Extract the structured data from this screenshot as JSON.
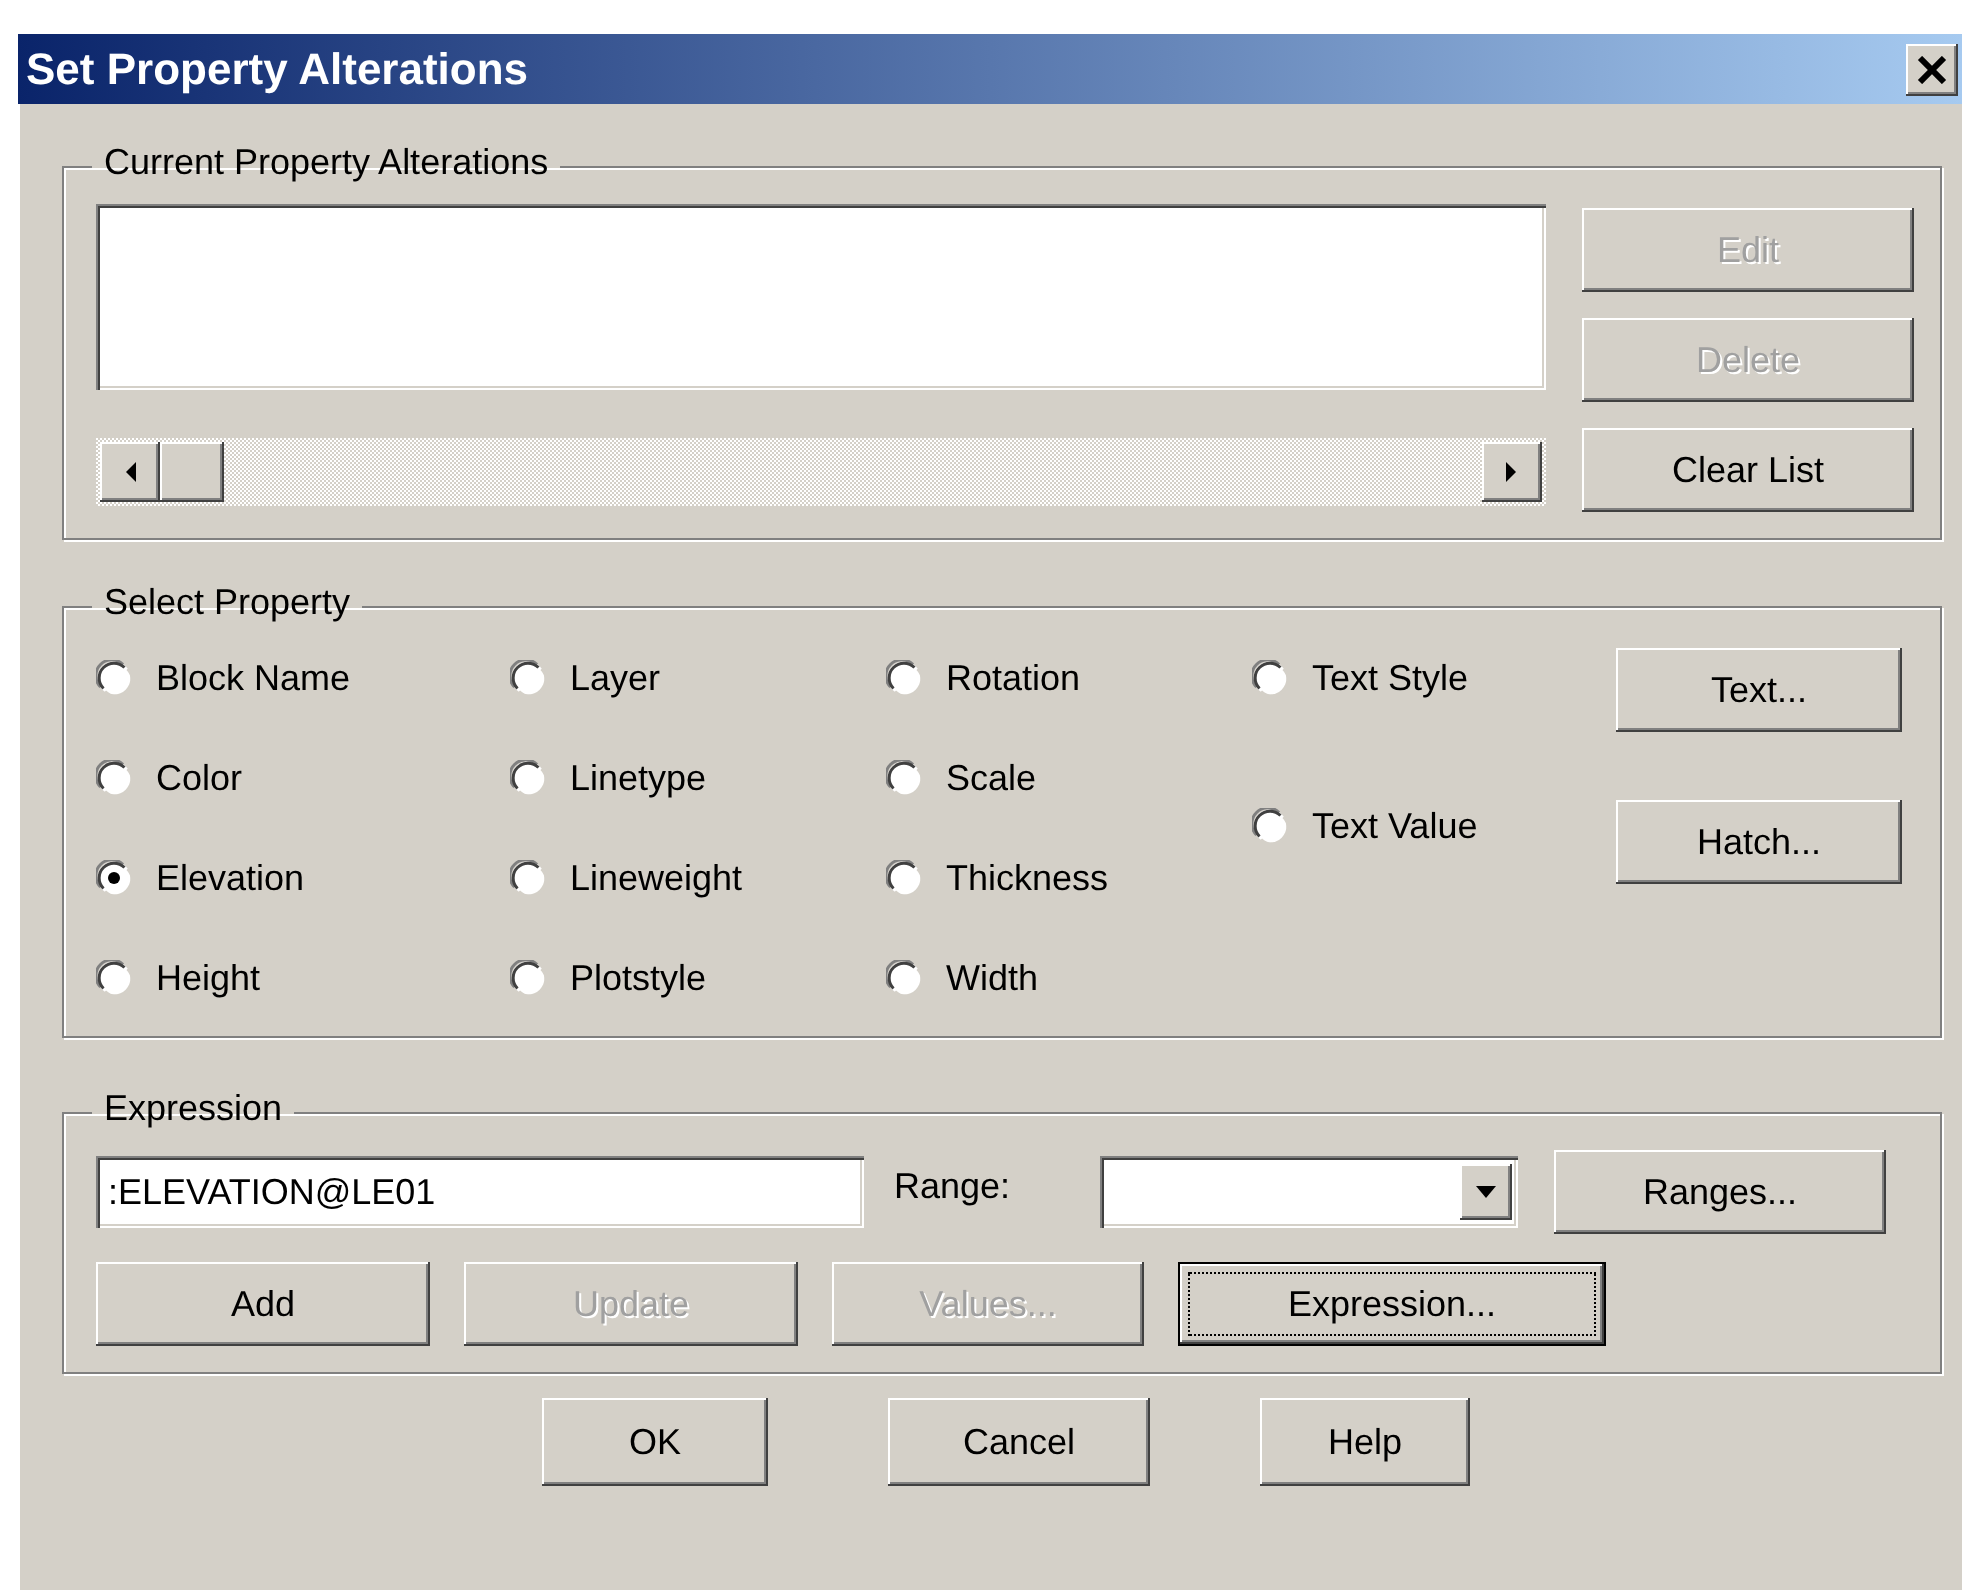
{
  "window": {
    "title": "Set Property Alterations"
  },
  "alterations": {
    "legend": "Current Property Alterations",
    "buttons": [
      {
        "label": "Edit",
        "disabled": true
      },
      {
        "label": "Delete",
        "disabled": true
      },
      {
        "label": "Clear List",
        "disabled": false
      }
    ]
  },
  "select_property": {
    "legend": "Select Property",
    "columns": [
      [
        {
          "label": "Block Name",
          "selected": false
        },
        {
          "label": "Color",
          "selected": false
        },
        {
          "label": "Elevation",
          "selected": true
        },
        {
          "label": "Height",
          "selected": false
        }
      ],
      [
        {
          "label": "Layer",
          "selected": false
        },
        {
          "label": "Linetype",
          "selected": false
        },
        {
          "label": "Lineweight",
          "selected": false
        },
        {
          "label": "Plotstyle",
          "selected": false
        }
      ],
      [
        {
          "label": "Rotation",
          "selected": false
        },
        {
          "label": "Scale",
          "selected": false
        },
        {
          "label": "Thickness",
          "selected": false
        },
        {
          "label": "Width",
          "selected": false
        }
      ],
      [
        {
          "label": "Text Style",
          "selected": false
        },
        {
          "label": "Text Value",
          "selected": false
        }
      ]
    ],
    "buttons": [
      {
        "label": "Text...",
        "disabled": false
      },
      {
        "label": "Hatch...",
        "disabled": false
      }
    ]
  },
  "expression": {
    "legend": "Expression",
    "value": ":ELEVATION@LE01",
    "range_label": "Range:",
    "ranges_button": {
      "label": "Ranges...",
      "disabled": false
    },
    "buttons": [
      {
        "label": "Add",
        "disabled": false,
        "focused": false
      },
      {
        "label": "Update",
        "disabled": true,
        "focused": false
      },
      {
        "label": "Values...",
        "disabled": true,
        "focused": false
      },
      {
        "label": "Expression...",
        "disabled": false,
        "focused": true
      }
    ]
  },
  "dialog_buttons": [
    {
      "label": "OK"
    },
    {
      "label": "Cancel"
    },
    {
      "label": "Help"
    }
  ]
}
